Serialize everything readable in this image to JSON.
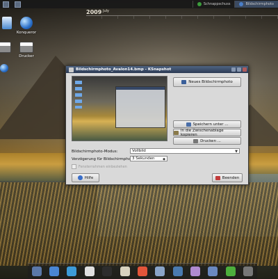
{
  "desktop": {
    "calendar": {
      "year": "2009",
      "month": "July"
    },
    "icons": [
      {
        "label": "Konqueror",
        "icon": "globe-icon"
      },
      {
        "label": "Drucker",
        "icon": "printer-icon"
      }
    ]
  },
  "panel": {
    "tasks": [
      {
        "label": "Schnappschuss",
        "active": false
      },
      {
        "label": "Bildschirmphoto",
        "active": true
      }
    ]
  },
  "dialog": {
    "title": "Bildschirmphoto_Avalon14.bmp - KSnapshot",
    "buttons": {
      "new_snapshot": "Neues Bildschirmphoto",
      "save_as": "Speichern unter ...",
      "copy_clipboard": "In die Zwischenablage kopieren",
      "print": "Drucken ...",
      "help": "Hilfe",
      "close": "Beenden"
    },
    "mode_label": "Bildschirmphoto-Modus:",
    "mode_value": "Vollbild",
    "delay_label": "Verzögerung für Bildschirmphoto:",
    "delay_value": "3 Sekunden",
    "checkbox_label": "Fensterrahmen einbeziehen"
  },
  "colors": {
    "titlebar": "#2c3b55",
    "dialog_bg": "#d9d9d9"
  }
}
